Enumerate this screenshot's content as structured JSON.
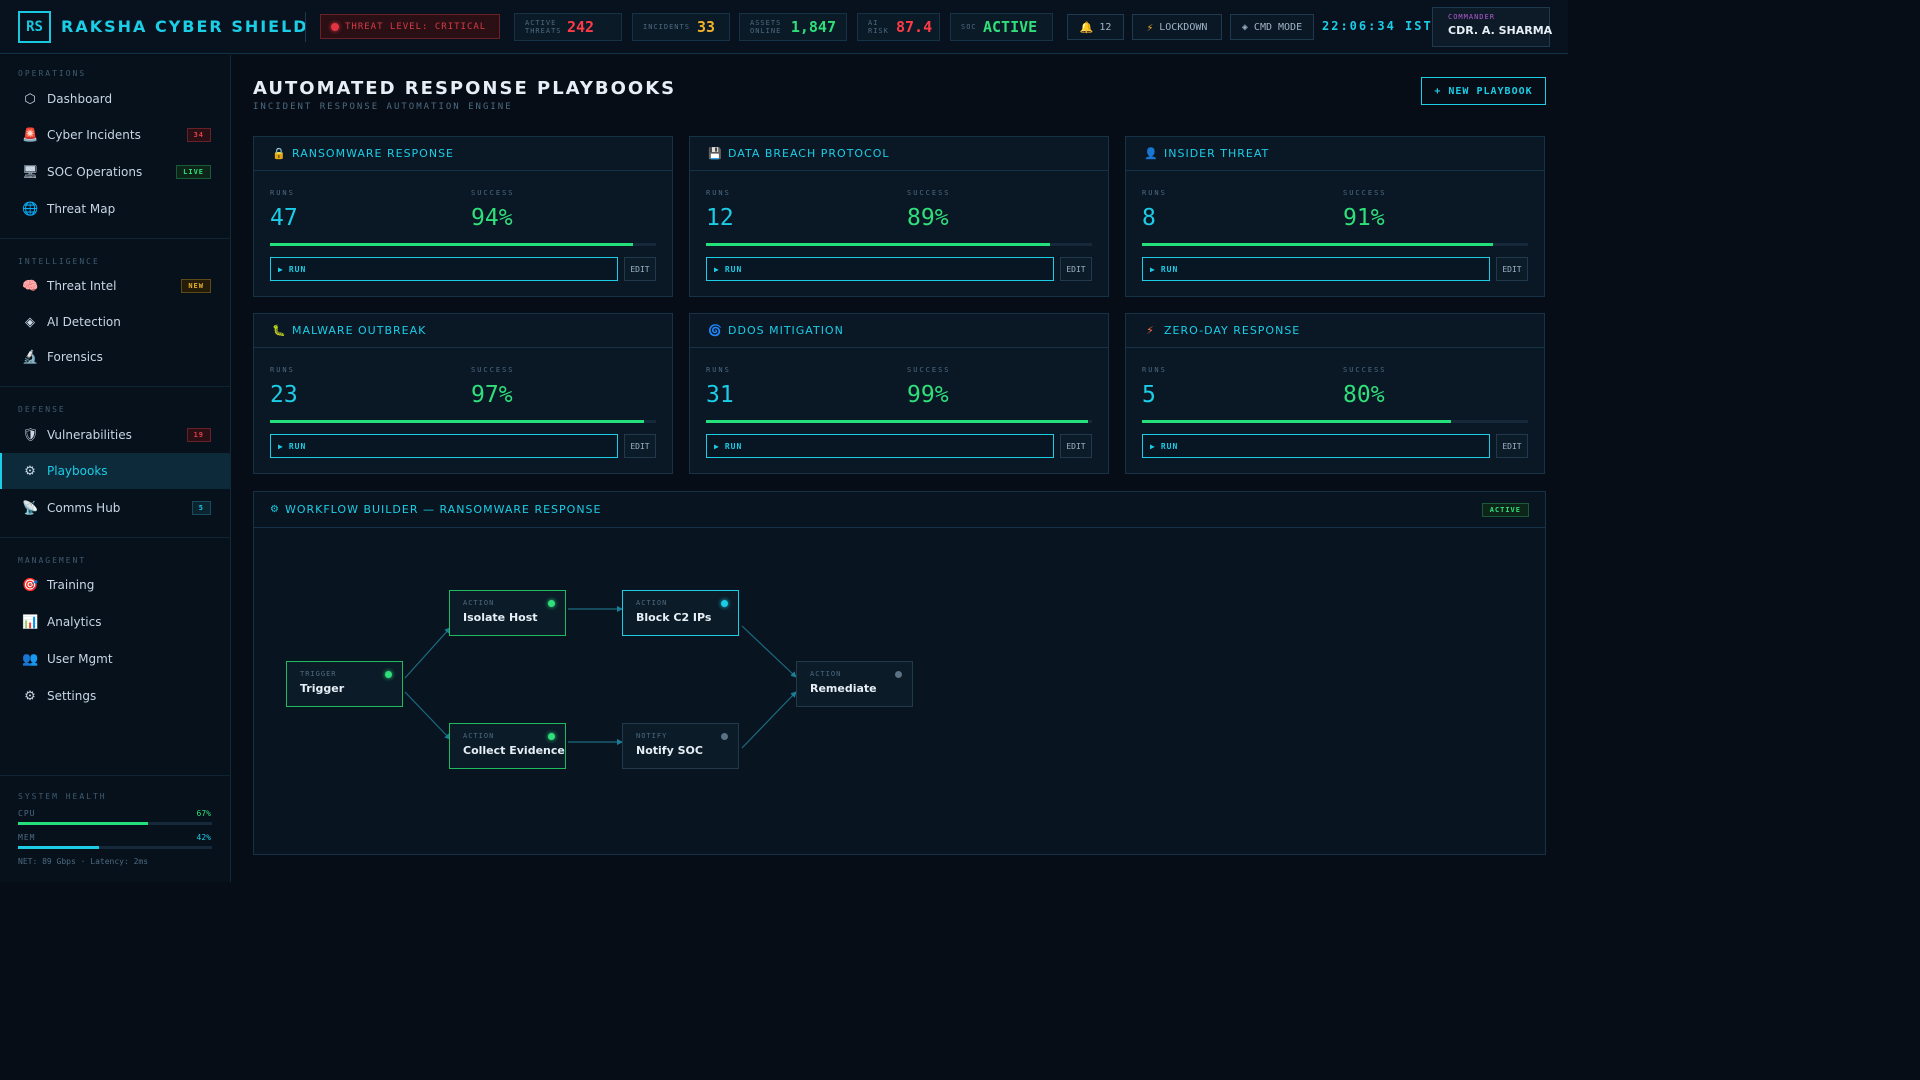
{
  "header": {
    "logo": "RS",
    "title": "RAKSHA CYBER SHIELD",
    "threat_level": "THREAT LEVEL: CRITICAL",
    "stats": [
      {
        "label": "ACTIVE THREATS",
        "value": "242",
        "color": "#ff3b45"
      },
      {
        "label": "INCIDENTS",
        "value": "33",
        "color": "#f2b12a"
      },
      {
        "label": "ASSETS ONLINE",
        "value": "1,847",
        "color": "#2fe07a"
      },
      {
        "label": "AI RISK",
        "value": "87.4",
        "color": "#ff3b45"
      },
      {
        "label": "SOC",
        "value": "ACTIVE",
        "color": "#2fe07a"
      }
    ],
    "notifications": "12",
    "lockdown": "LOCKDOWN",
    "cmd_mode": "CMD MODE",
    "clock": "22:06:34 IST",
    "commander_role": "COMMANDER",
    "commander_name": "CDR. A. SHARMA"
  },
  "sidebar": {
    "sections": [
      {
        "label": "OPERATIONS",
        "items": [
          {
            "icon": "hexagon-icon",
            "glyph": "⬡",
            "label": "Dashboard"
          },
          {
            "icon": "siren-icon",
            "glyph": "🚨",
            "label": "Cyber Incidents",
            "badge": "34",
            "badge_style": "red"
          },
          {
            "icon": "server-icon",
            "glyph": "🖥",
            "label": "SOC Operations",
            "badge": "LIVE",
            "badge_style": "green"
          },
          {
            "icon": "globe-icon",
            "glyph": "🌐",
            "label": "Threat Map"
          }
        ]
      },
      {
        "label": "INTELLIGENCE",
        "items": [
          {
            "icon": "brain-icon",
            "glyph": "🧠",
            "label": "Threat Intel",
            "badge": "NEW",
            "badge_style": "amber"
          },
          {
            "icon": "diamond-icon",
            "glyph": "◈",
            "label": "AI Detection"
          },
          {
            "icon": "microscope-icon",
            "glyph": "🔬",
            "label": "Forensics"
          }
        ]
      },
      {
        "label": "DEFENSE",
        "items": [
          {
            "icon": "shield-icon",
            "glyph": "🛡",
            "label": "Vulnerabilities",
            "badge": "19",
            "badge_style": "red"
          },
          {
            "icon": "gear-icon",
            "glyph": "⚙",
            "label": "Playbooks",
            "active": true
          },
          {
            "icon": "satellite-icon",
            "glyph": "📡",
            "label": "Comms Hub",
            "badge": "5",
            "badge_style": "cyan"
          }
        ]
      },
      {
        "label": "MANAGEMENT",
        "items": [
          {
            "icon": "target-icon",
            "glyph": "🎯",
            "label": "Training"
          },
          {
            "icon": "chart-icon",
            "glyph": "📊",
            "label": "Analytics"
          },
          {
            "icon": "users-icon",
            "glyph": "👥",
            "label": "User Mgmt"
          },
          {
            "icon": "settings-icon",
            "glyph": "⚙",
            "label": "Settings"
          }
        ]
      }
    ],
    "health": {
      "label": "SYSTEM HEALTH",
      "cpu_label": "CPU",
      "cpu_value": "67%",
      "cpu_pct": 67,
      "mem_label": "MEM",
      "mem_value": "42%",
      "mem_pct": 42,
      "net": "NET: 89 Gbps · Latency: 2ms"
    }
  },
  "main": {
    "title": "AUTOMATED RESPONSE PLAYBOOKS",
    "subtitle": "INCIDENT RESPONSE AUTOMATION ENGINE",
    "new_button": "+ NEW PLAYBOOK",
    "runs_label": "RUNS",
    "success_label": "SUCCESS",
    "run_label": "RUN",
    "edit_label": "EDIT",
    "playbooks": [
      {
        "icon": "lock-icon",
        "glyph": "🔒",
        "name": "RANSOMWARE RESPONSE",
        "runs": "47",
        "success": "94%",
        "pct": 94
      },
      {
        "icon": "floppy-icon",
        "glyph": "💾",
        "name": "DATA BREACH PROTOCOL",
        "runs": "12",
        "success": "89%",
        "pct": 89
      },
      {
        "icon": "user-icon",
        "glyph": "👤",
        "name": "INSIDER THREAT",
        "runs": "8",
        "success": "91%",
        "pct": 91
      },
      {
        "icon": "bug-icon",
        "glyph": "🐛",
        "name": "MALWARE OUTBREAK",
        "runs": "23",
        "success": "97%",
        "pct": 97
      },
      {
        "icon": "cyclone-icon",
        "glyph": "🌀",
        "name": "DDOS MITIGATION",
        "runs": "31",
        "success": "99%",
        "pct": 99
      },
      {
        "icon": "lightning-icon",
        "glyph": "⚡",
        "name": "ZERO-DAY RESPONSE",
        "runs": "5",
        "success": "80%",
        "pct": 80
      }
    ],
    "workflow": {
      "title": "WORKFLOW BUILDER — RANSOMWARE RESPONSE",
      "status": "ACTIVE",
      "nodes": [
        {
          "id": "trigger",
          "type": "TRIGGER",
          "name": "Trigger",
          "state": "green"
        },
        {
          "id": "isolate",
          "type": "ACTION",
          "name": "Isolate Host",
          "state": "green"
        },
        {
          "id": "block",
          "type": "ACTION",
          "name": "Block C2 IPs",
          "state": "cyan"
        },
        {
          "id": "collect",
          "type": "ACTION",
          "name": "Collect Evidence",
          "state": "green"
        },
        {
          "id": "notify",
          "type": "NOTIFY",
          "name": "Notify SOC",
          "state": "idle"
        },
        {
          "id": "remediate",
          "type": "ACTION",
          "name": "Remediate",
          "state": "idle"
        }
      ]
    }
  }
}
